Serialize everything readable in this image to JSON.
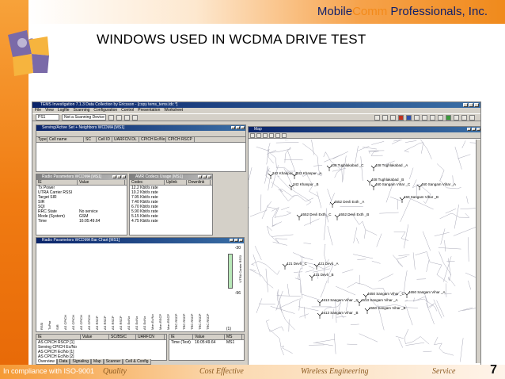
{
  "slide": {
    "brand_mobile": "Mobile",
    "brand_comm": "Comm",
    "brand_rest": " Professionals, Inc.",
    "title": "WINDOWS USED IN WCDMA DRIVE TEST",
    "footer": {
      "iso": "In compliance with ISO-9001",
      "quality": "Quality",
      "cost": "Cost Effective",
      "wireless": "Wireless Engineering",
      "service": "Service"
    },
    "page_number": "7",
    "colors": {
      "orange": "#f07b12",
      "navy": "#0f1f6b"
    }
  },
  "app": {
    "title": "TEMS Investigation 7.1.3 Data Collection by Ericsson - [copy tems_tems.tdc *]",
    "menu": [
      "File",
      "View",
      "Logfile",
      "Scanning",
      "Configuration",
      "Control",
      "Presentation",
      "Worksheet"
    ],
    "toolbar": {
      "device_combo": "PS1",
      "mode_combo": "Not a Scanning Device"
    },
    "windows": {
      "serving": {
        "title": "Serving/Active Set + Neighbors WCDMA [MS1]",
        "columns": [
          "Type",
          "Cell name",
          "SC",
          "Cell ID",
          "UARFCN DL",
          "CPICH Ec/No",
          "CPICH RSCP"
        ]
      },
      "radio_params": {
        "title": "Radio Parameters WCDMA [MS1]",
        "columns": [
          "IE",
          "Value"
        ],
        "rows": [
          {
            "ie": "Tx Power",
            "value": ""
          },
          {
            "ie": "UTRA Carrier RSSI",
            "value": ""
          },
          {
            "ie": "Target SIR",
            "value": ""
          },
          {
            "ie": "SIR",
            "value": ""
          },
          {
            "ie": "SQI",
            "value": ""
          },
          {
            "ie": "RRC State",
            "value": "No service"
          },
          {
            "ie": "Mode (System)",
            "value": "GSM"
          },
          {
            "ie": "Time",
            "value": "16:05:49.64"
          }
        ]
      },
      "amr": {
        "title": "AMR Codecs Usage [MS1]",
        "columns": [
          "Codec",
          "Uplink",
          "Downlink"
        ],
        "rows": [
          "12.2 Kbit/s rate",
          "10.2 Kbit/s rate",
          "7.95 Kbit/s rate",
          "7.40 Kbit/s rate",
          "6.70 Kbit/s rate",
          "5.90 Kbit/s rate",
          "5.15 Kbit/s rate",
          "4.75 Kbit/s rate"
        ]
      },
      "bar_chart": {
        "title": "Radio Parameters WCDMA Bar Chart [MS1]",
        "y_ticks": [
          "-30",
          "-96"
        ],
        "y_label": "UTRA Carrier RSSI",
        "x_labels": [
          "RSSI",
          "TxPwr",
          "SIR",
          "AS CPICH",
          "AS CPICH",
          "AS CPICH",
          "AS CPICH",
          "AS RSCP",
          "AS RSCP",
          "AS RSCP",
          "AS RSCP",
          "AS Ec/No",
          "AS Ec/No",
          "AS Ec/No",
          "Mon Ec/No",
          "Mon RSCP",
          "Mon RSCP",
          "TRC RSCP",
          "TRC RSCP",
          "TRC RSCP",
          "TRC RSCP",
          "TRC RSCP"
        ],
        "bottom_value": "(1)"
      },
      "ie_table": {
        "columns": [
          "IE",
          "Value",
          "SC/BSIC",
          "UARFCN"
        ],
        "rows": [
          "AS CPICH RSCP [1]",
          "Serving CPICH Ec/No",
          "AS CPICH Ec/No [1]",
          "AS CPICH Ec/No [2]"
        ]
      },
      "event_table": {
        "columns": [
          "IE",
          "Value",
          "MS"
        ],
        "rows": [
          {
            "ie": "Time (Text)",
            "value": "16:05:49.64",
            "ms": "MS1"
          }
        ]
      },
      "map": {
        "title": "Map",
        "sites": [
          "408 Tughlakabad _C",
          "408 Tughlakabad _A",
          "342 Khanpur _C",
          "342 Khanpur _A",
          "408 Tughlakabad _B",
          "342 Khanpur _B",
          "460 Sangam Vihar _C",
          "460 Sangam Vihar _A",
          "460 Sangam Vihar _B",
          "4652 Devli Exth _A",
          "4652 Devli Exth _C",
          "4652 Devli Exth _B",
          "421 Devli _C",
          "421 Devli _A",
          "421 Devli _B",
          "4650 Sangam Vihar _C",
          "4650 Sangam Vihar _A",
          "4613 Sangam Vihar _C",
          "4613 Sangam Vihar _A",
          "4650 Sangam Vihar _B",
          "4613 Sangam Vihar _B"
        ]
      }
    },
    "status_tabs": [
      "Overview",
      "Data",
      "Signaling",
      "Map",
      "Scanner",
      "Cell & Config"
    ]
  }
}
